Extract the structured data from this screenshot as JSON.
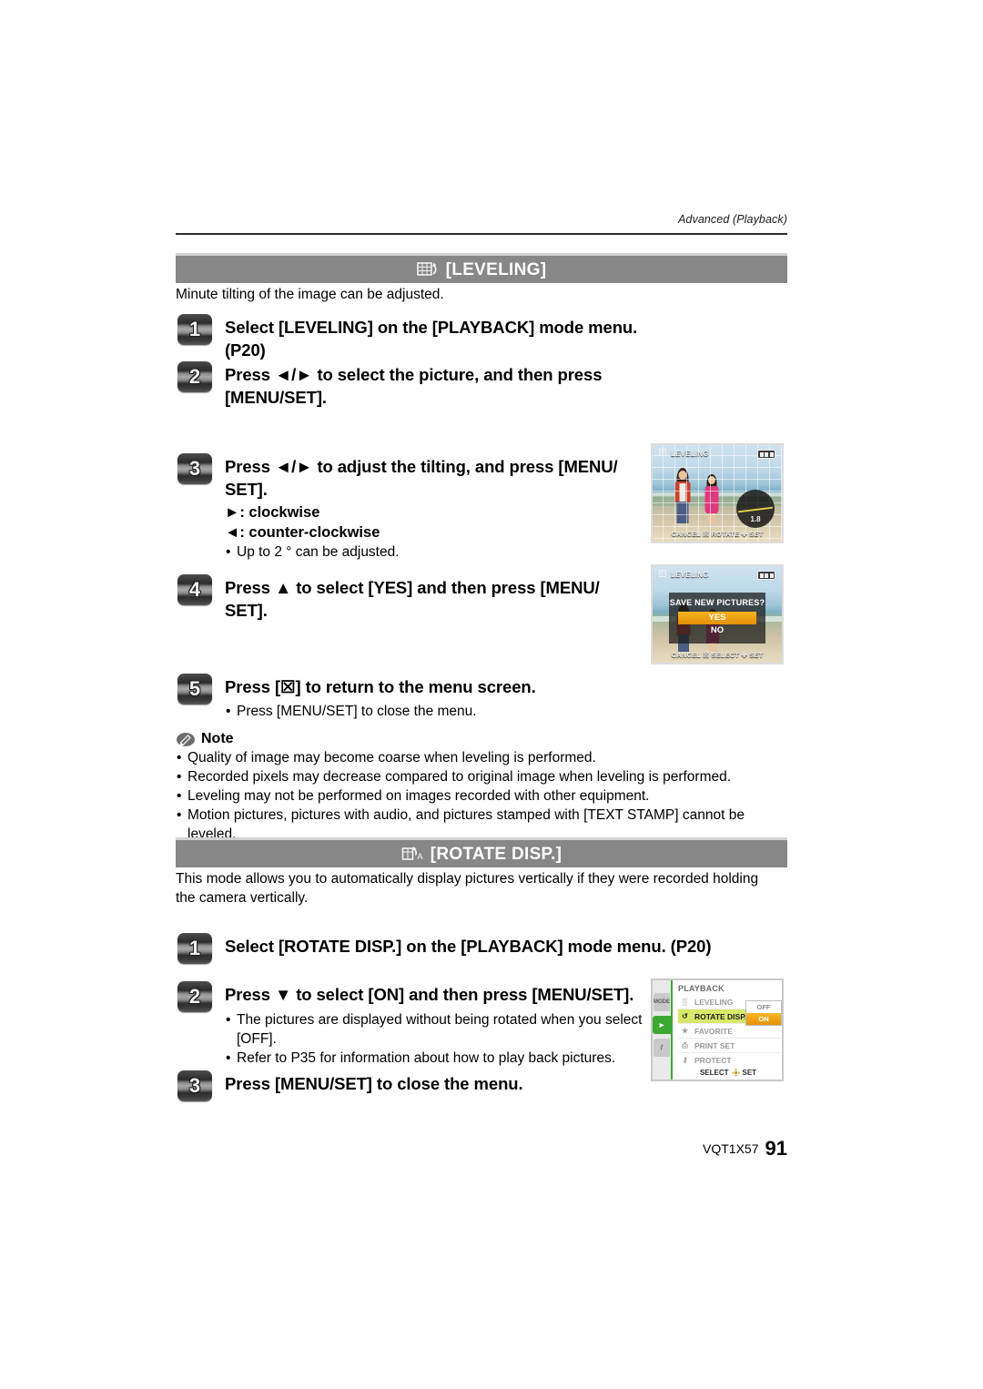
{
  "running_head": "Advanced (Playback)",
  "sections": [
    {
      "id": "leveling",
      "icon_name": "grid-rotate-icon",
      "title": "[LEVELING]",
      "intro": "Minute tilting of the image can be adjusted.",
      "steps": [
        {
          "num": "1",
          "text": "Select [LEVELING] on the [PLAYBACK] mode menu. (P20)",
          "subs": []
        },
        {
          "num": "2",
          "text": "Press ◄/► to select the picture, and then press [MENU/SET].",
          "subs": []
        },
        {
          "num": "3",
          "text": "Press ◄/► to adjust the tilting, and press [MENU/ SET].",
          "subs": [
            {
              "style": "strong",
              "text": "►: clockwise"
            },
            {
              "style": "strong",
              "text": "◄: counter-clockwise"
            },
            {
              "style": "bullet",
              "text": "Up to 2 ° can be adjusted."
            }
          ]
        },
        {
          "num": "4",
          "text": "Press ▲ to select [YES] and then press [MENU/ SET].",
          "subs": []
        },
        {
          "num": "5",
          "text": "Press [☒] to return to the menu screen.",
          "subs": [
            {
              "style": "bullet",
              "text": "Press [MENU/SET] to close the menu."
            }
          ]
        }
      ],
      "note": {
        "label": "Note",
        "icon_name": "note-pencil-icon",
        "items": [
          "Quality of image may become coarse when leveling is performed.",
          "Recorded pixels may decrease compared to original image when leveling is performed.",
          "Leveling may not be performed on images recorded with other equipment.",
          "Motion pictures, pictures with audio, and pictures stamped with [TEXT STAMP] cannot be leveled."
        ]
      }
    },
    {
      "id": "rotate-disp",
      "icon_name": "rotate-display-auto-icon",
      "title": "[ROTATE DISP.]",
      "intro": "This mode allows you to automatically display pictures vertically if they were recorded holding the camera vertically.",
      "steps": [
        {
          "num": "1",
          "text": "Select [ROTATE DISP.] on the [PLAYBACK] mode menu. (P20)",
          "subs": []
        },
        {
          "num": "2",
          "text": "Press ▼ to select [ON] and then press [MENU/SET].",
          "subs": [
            {
              "style": "bullet",
              "text": "The pictures are displayed without being rotated when you select [OFF]."
            },
            {
              "style": "bullet",
              "text": "Refer to P35 for information about how to play back pictures."
            }
          ]
        },
        {
          "num": "3",
          "text": "Press [MENU/SET] to close the menu.",
          "subs": []
        }
      ]
    }
  ],
  "lcd_leveling": {
    "top_label": "LEVELING",
    "bottom_bar": "CANCEL ☒ ROTATE ✤ SET",
    "tilt_value": "1.8",
    "battery_name": "battery-full-icon"
  },
  "lcd_save": {
    "top_label": "LEVELING",
    "question": "SAVE NEW PICTURES?",
    "option_yes": "YES",
    "option_no": "NO",
    "selected": "YES",
    "bottom_bar": "CANCEL ☒ SELECT ✤ SET"
  },
  "lcd_menu": {
    "title": "PLAYBACK",
    "tabs": [
      {
        "label": "MODE",
        "active": false
      },
      {
        "label": "▶",
        "active": true
      },
      {
        "label": "ƒ",
        "active": false
      }
    ],
    "rows": [
      {
        "icon": "leveling-icon",
        "glyph": "▒",
        "label": "LEVELING",
        "selected": false
      },
      {
        "icon": "rotate-disp-icon",
        "glyph": "↺",
        "label": "ROTATE DISP.",
        "selected": true
      },
      {
        "icon": "favorite-star-icon",
        "glyph": "★",
        "label": "FAVORITE",
        "selected": false
      },
      {
        "icon": "print-set-icon",
        "glyph": "⎙",
        "label": "PRINT SET",
        "selected": false
      },
      {
        "icon": "protect-key-icon",
        "glyph": "⚷",
        "label": "PROTECT",
        "selected": false
      }
    ],
    "options": [
      {
        "label": "OFF",
        "selected": false
      },
      {
        "label": "ON",
        "selected": true
      }
    ],
    "footer": "SELECT",
    "footer_suffix": "SET"
  },
  "footer": {
    "doc_code": "VQT1X57",
    "page_number": "91"
  },
  "colors": {
    "header_bar": "#878787",
    "menu_highlight": "#d8e86a",
    "menu_tab_active": "#3ea832",
    "option_selected": "#e6910a"
  }
}
